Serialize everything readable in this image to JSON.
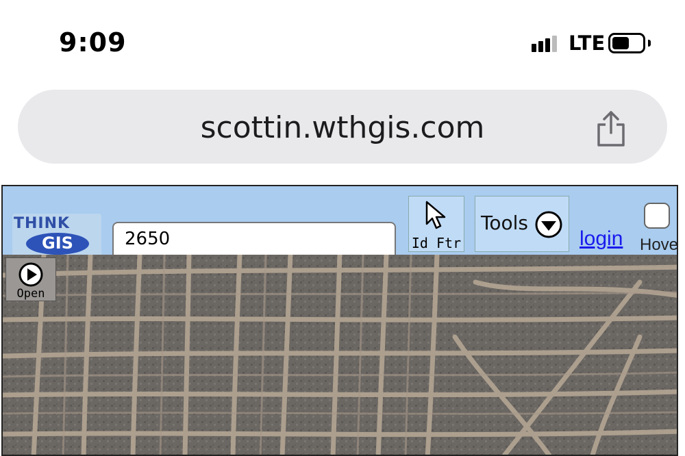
{
  "status_bar": {
    "time": "9:09",
    "network": "LTE",
    "icons": [
      "signal-icon",
      "battery-icon"
    ]
  },
  "browser": {
    "url": "scottin.wthgis.com",
    "share_icon": "share-icon"
  },
  "page": {
    "logo": {
      "line1": "THINK",
      "line2": "GIS"
    },
    "search": {
      "value": "2650"
    },
    "toolbar": {
      "id_feature_label": "Id Ftr",
      "id_feature_icon": "cursor-arrow-icon",
      "tools_label": "Tools",
      "tools_icon": "chevron-down-circle-icon",
      "login_label": "login",
      "hover_label": "Hove"
    },
    "map": {
      "open_label": "Open",
      "open_icon": "play-icon"
    }
  },
  "colors": {
    "header_bg": "#a9ccef",
    "button_bg": "#c0dbf6",
    "link": "#1a1aee",
    "map_bg": "#6e6a66",
    "map_roads": "#b8a996"
  }
}
